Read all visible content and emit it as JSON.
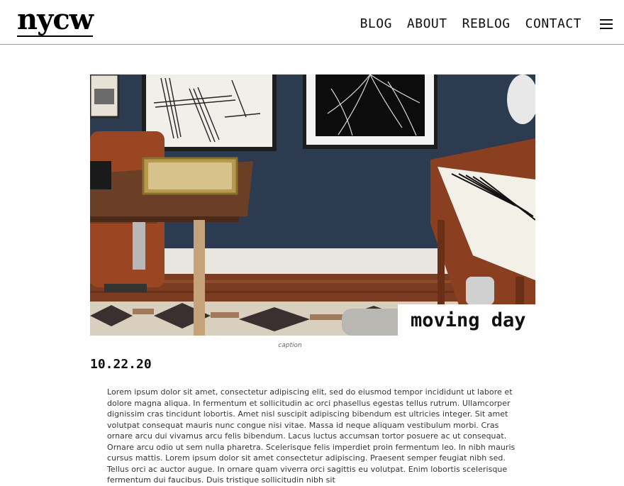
{
  "site": {
    "logo": "nycw"
  },
  "nav": {
    "items": [
      {
        "label": "BLOG"
      },
      {
        "label": "ABOUT"
      },
      {
        "label": "REBLOG"
      },
      {
        "label": "CONTACT"
      }
    ],
    "menu_icon": "hamburger-menu-icon"
  },
  "post": {
    "title": "moving day",
    "caption": "caption",
    "date": "10.22.20",
    "body": "Lorem ipsum dolor sit amet, consectetur adipiscing elit, sed do eiusmod tempor incididunt ut labore et dolore magna aliqua. In fermentum et sollicitudin ac orci phasellus egestas tellus rutrum. Ullamcorper dignissim cras tincidunt lobortis. Amet nisl suscipit adipiscing bibendum est ultricies integer. Sit amet volutpat consequat mauris nunc congue nisi vitae. Massa id neque aliquam vestibulum morbi. Cras ornare arcu dui vivamus arcu felis bibendum. Lacus luctus accumsan tortor posuere ac ut consequat. Ornare arcu odio ut sem nulla pharetra. Scelerisque felis imperdiet proin fermentum leo. In nibh mauris cursus mattis. Lorem ipsum dolor sit amet consectetur adipiscing. Praesent semper feugiat nibh sed. Tellus orci ac auctor augue. In ornare quam viverra orci sagittis eu volutpat. Enim lobortis scelerisque fermentum dui faucibus. Duis tristique sollicitudin nibh sit"
  },
  "colors": {
    "wall": "#2c3b4f",
    "wood": "#8a4a2a",
    "accent_text": "#111111"
  }
}
